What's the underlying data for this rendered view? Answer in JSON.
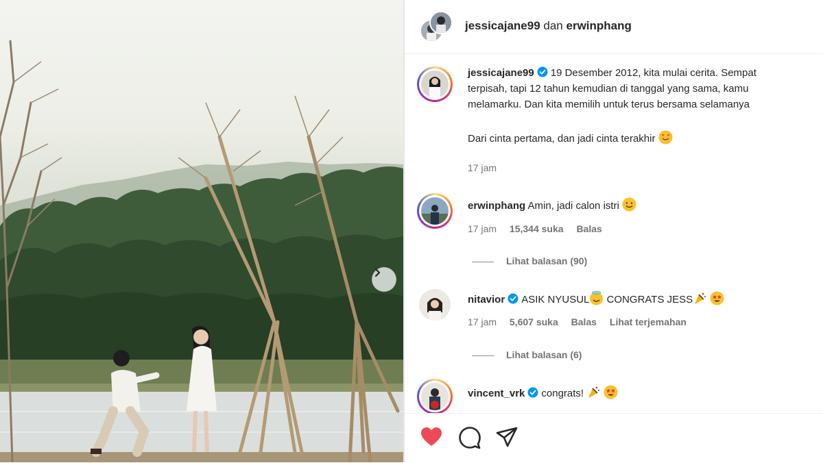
{
  "header": {
    "user1": "jessicajane99",
    "conjunction": "dan",
    "user2": "erwinphang"
  },
  "caption": {
    "username": "jessicajane99",
    "line1": "19 Desember 2012, kita mulai cerita. Sempat",
    "line2": "terpisah, tapi 12 tahun kemudian di tanggal yang sama, kamu",
    "line3": "melamarku. Dan kita memilih untuk terus bersama selamanya",
    "line4": "Dari cinta pertama, dan jadi cinta terakhir",
    "time": "17 jam"
  },
  "comments": [
    {
      "username": "erwinphang",
      "text": "Amin, jadi calon istri",
      "time": "17 jam",
      "likes": "15,344 suka",
      "reply": "Balas",
      "view_replies": "Lihat balasan (90)"
    },
    {
      "username": "nitavior",
      "text_a": "ASIK NYUSUL",
      "text_b": "CONGRATS JESS",
      "time": "17 jam",
      "likes": "5,607 suka",
      "reply": "Balas",
      "translate": "Lihat terjemahan",
      "view_replies": "Lihat balasan (6)"
    },
    {
      "username": "vincent_vrk",
      "text": "congrats!"
    }
  ],
  "icons": {
    "like": "heart-filled-icon",
    "comment": "comment-icon",
    "share": "share-icon",
    "next": "chevron-right-icon",
    "verified": "verified-badge-icon"
  },
  "colors": {
    "verified": "#0095f6",
    "like": "#ed4956",
    "muted": "#737373"
  }
}
